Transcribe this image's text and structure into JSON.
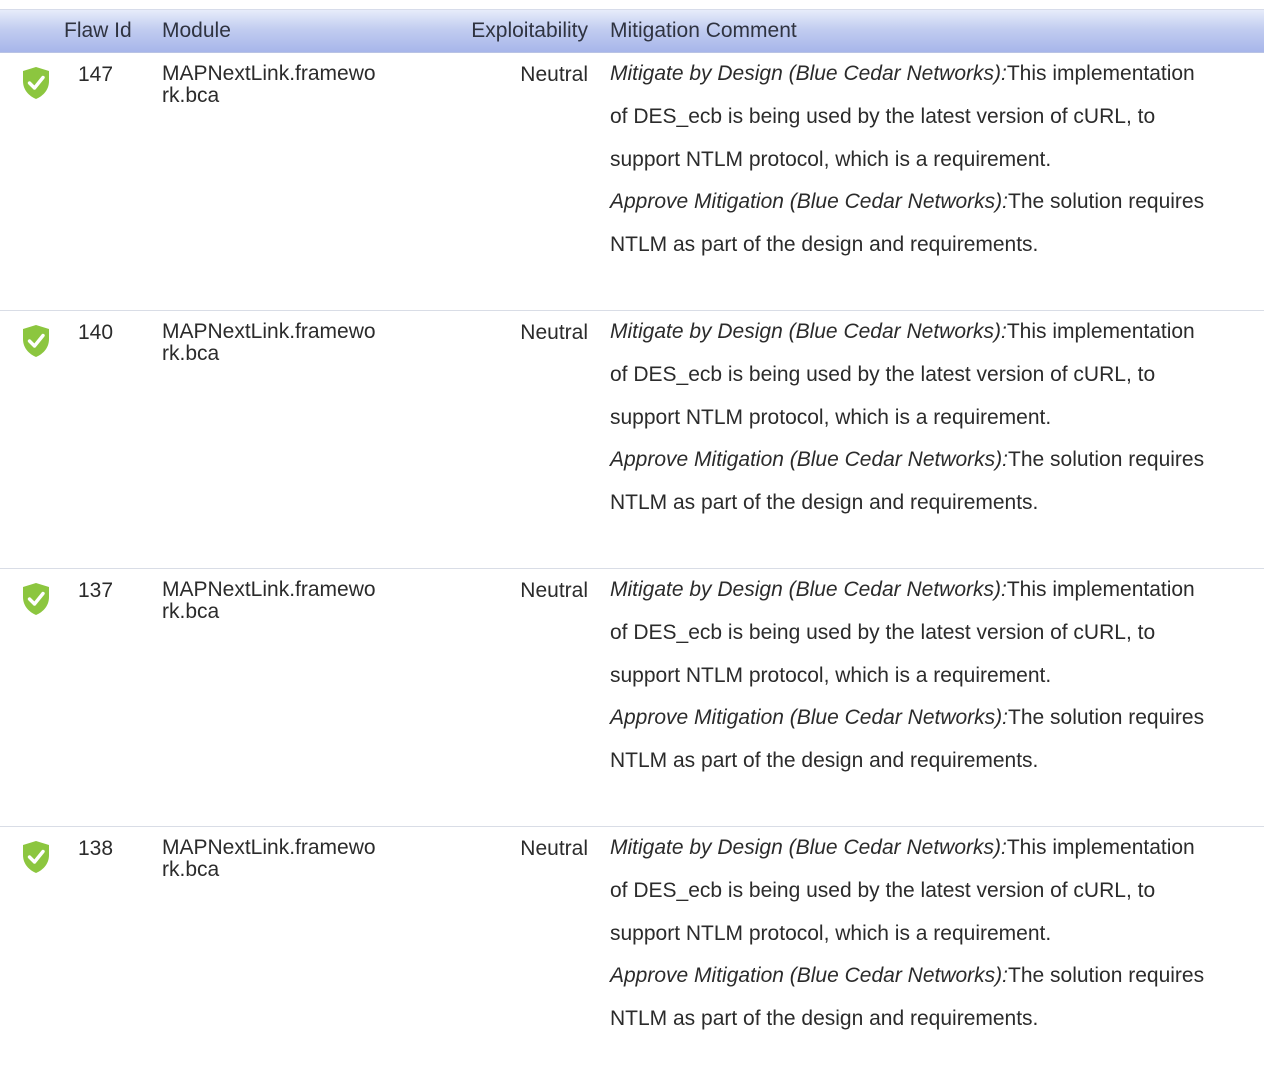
{
  "table": {
    "headers": {
      "flaw_id": "Flaw Id",
      "module": "Module",
      "exploitability": "Exploitability",
      "mitigation_comment": "Mitigation Comment"
    },
    "rows": [
      {
        "status_icon": "shield-check-icon",
        "flaw_id": "147",
        "module_line1": "MAPNextLink.framewo",
        "module_line2": "rk.bca",
        "exploitability": "Neutral",
        "comments": [
          {
            "title": "Mitigate by Design (Blue Cedar Networks):",
            "text": "This implementation of DES_ecb is being used by the latest version of cURL, to support NTLM protocol, which is a requirement."
          },
          {
            "title": "Approve Mitigation (Blue Cedar Networks):",
            "text": "The solution requires NTLM as part of the design and requirements."
          }
        ]
      },
      {
        "status_icon": "shield-check-icon",
        "flaw_id": "140",
        "module_line1": "MAPNextLink.framewo",
        "module_line2": "rk.bca",
        "exploitability": "Neutral",
        "comments": [
          {
            "title": "Mitigate by Design (Blue Cedar Networks):",
            "text": "This implementation of DES_ecb is being used by the latest version of cURL, to support NTLM protocol, which is a requirement."
          },
          {
            "title": "Approve Mitigation (Blue Cedar Networks):",
            "text": "The solution requires NTLM as part of the design and requirements."
          }
        ]
      },
      {
        "status_icon": "shield-check-icon",
        "flaw_id": "137",
        "module_line1": "MAPNextLink.framewo",
        "module_line2": "rk.bca",
        "exploitability": "Neutral",
        "comments": [
          {
            "title": "Mitigate by Design (Blue Cedar Networks):",
            "text": "This implementation of DES_ecb is being used by the latest version of cURL, to support NTLM protocol, which is a requirement."
          },
          {
            "title": "Approve Mitigation (Blue Cedar Networks):",
            "text": "The solution requires NTLM as part of the design and requirements."
          }
        ]
      },
      {
        "status_icon": "shield-check-icon",
        "flaw_id": "138",
        "module_line1": "MAPNextLink.framewo",
        "module_line2": "rk.bca",
        "exploitability": "Neutral",
        "comments": [
          {
            "title": "Mitigate by Design (Blue Cedar Networks):",
            "text": "This implementation of DES_ecb is being used by the latest version of cURL, to support NTLM protocol, which is a requirement."
          },
          {
            "title": "Approve Mitigation (Blue Cedar Networks):",
            "text": "The solution requires NTLM as part of the design and requirements."
          }
        ]
      }
    ]
  },
  "colors": {
    "shield": "#8cc63f",
    "header_gradient_top": "#e7ecfa",
    "header_gradient_bottom": "#a7b6ea",
    "row_divider": "#d9dde6"
  }
}
